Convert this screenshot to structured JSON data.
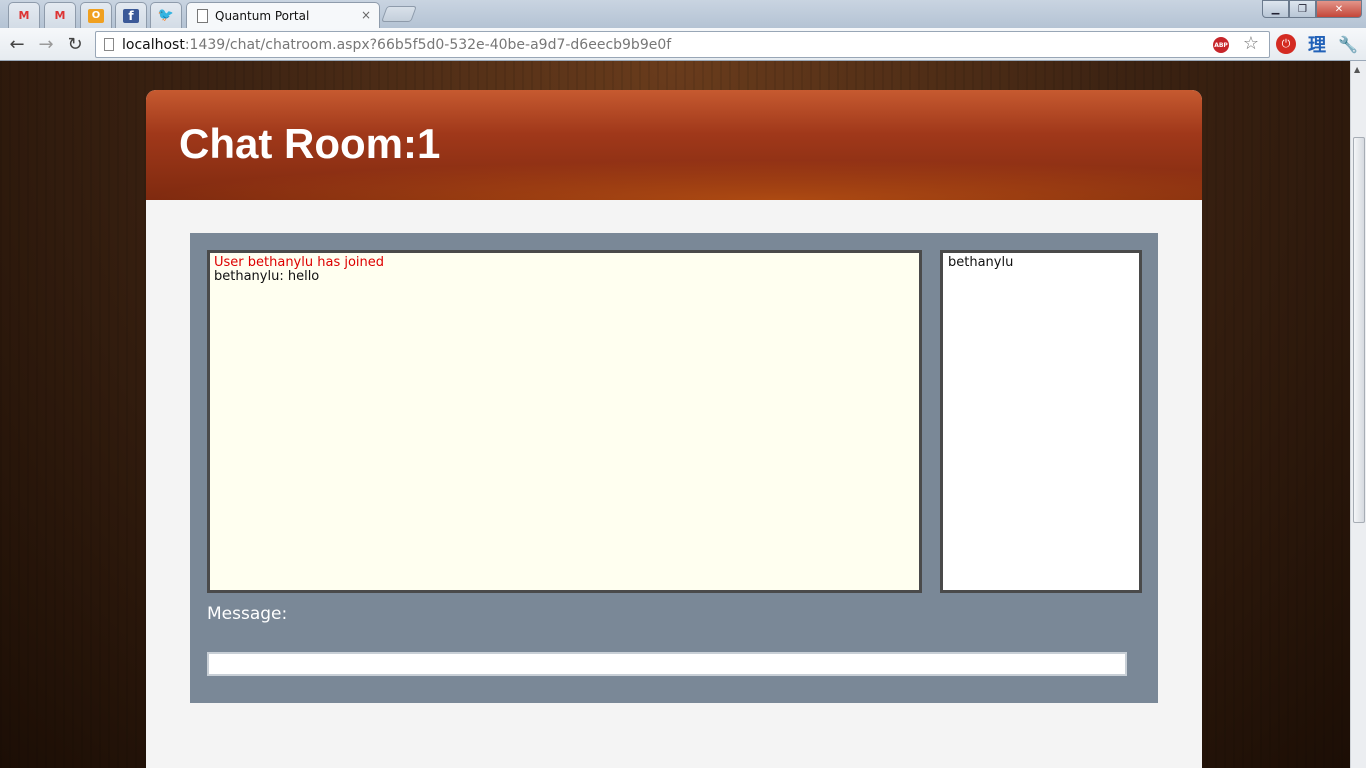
{
  "browser": {
    "tabs": [
      {
        "icon": "gmail-icon",
        "glyph": "M"
      },
      {
        "icon": "gmail-icon",
        "glyph": "M"
      },
      {
        "icon": "outlook-icon",
        "glyph": "O"
      },
      {
        "icon": "facebook-icon",
        "glyph": "f"
      },
      {
        "icon": "twitter-icon",
        "glyph": "🐦"
      }
    ],
    "active_tab": {
      "title": "Quantum Portal",
      "close": "×"
    },
    "url_host": "localhost",
    "url_rest": ":1439/chat/chatroom.aspx?66b5f5d0-532e-40be-a9d7-d6eecb9b9e0f",
    "extensions": {
      "abp": "ABP",
      "kanji": "理"
    }
  },
  "page": {
    "title": "Chat Room:1"
  },
  "chat": {
    "messages": [
      {
        "type": "system",
        "text": "User bethanylu has joined"
      },
      {
        "type": "user",
        "text": "bethanylu: hello"
      }
    ],
    "users": [
      "bethanylu"
    ],
    "message_label": "Message:",
    "message_value": ""
  },
  "colors": {
    "header_accent": "#a0381a",
    "panel": "#7a8897",
    "messages_bg": "#fffff0",
    "system_message": "#dd0000"
  }
}
